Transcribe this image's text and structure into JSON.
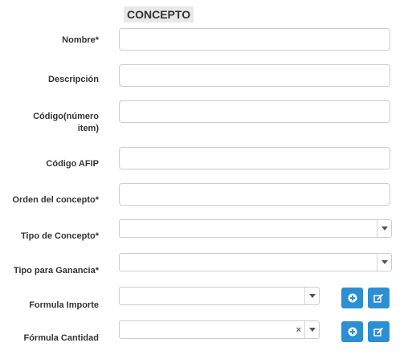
{
  "form": {
    "title": "CONCEPTO",
    "fields": {
      "nombre": {
        "label": "Nombre*",
        "value": ""
      },
      "descripcion": {
        "label": "Descripción",
        "value": ""
      },
      "codigo": {
        "label_line1": "Código(número",
        "label_line2": "item)",
        "value": ""
      },
      "codigo_afip": {
        "label": "Código AFIP",
        "value": ""
      },
      "orden": {
        "label": "Orden del concepto*",
        "value": ""
      },
      "tipo_concepto": {
        "label": "Tipo de Concepto*",
        "selected": ""
      },
      "tipo_ganancia": {
        "label": "Tipo para Ganancia*",
        "selected": ""
      },
      "formula_importe": {
        "label": "Formula Importe",
        "selected": ""
      },
      "formula_cantidad": {
        "label": "Fórmula Cantidad",
        "selected": "",
        "clear": "×"
      }
    }
  },
  "icons": {
    "add": "plus-circle-icon",
    "edit": "edit-icon"
  },
  "colors": {
    "button_blue": "#2d8fd3",
    "title_bg": "#e8e8e8"
  }
}
